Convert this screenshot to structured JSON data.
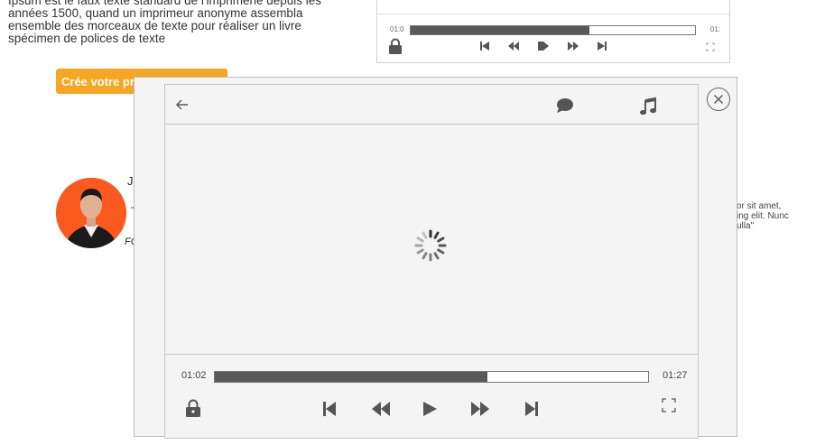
{
  "background": {
    "intro_lines": [
      "Ipsum est le faux texte standard de l'imprimerie depuis les",
      "années 1500, quand un imprimeur anonyme assembla",
      "ensemble des morceaux de texte pour réaliser un livre",
      "spécimen de polices de texte"
    ],
    "cta_label": "Crée votre premier",
    "mini_player": {
      "time_current": "01:0",
      "time_duration": "01:",
      "progress": 0.63
    },
    "profile_name_fragment": "J",
    "quote_fragment": "\"",
    "italic_fragment": "FO",
    "side_text": [
      "or sit amet,",
      "ing elit. Nunc",
      "ulla\""
    ]
  },
  "player": {
    "time_current": "01:02",
    "time_duration": "01:27",
    "progress": 0.63
  },
  "colors": {
    "accent": "#f5a623",
    "avatar_bg": "#fb5a1f",
    "progress_fill": "#595959",
    "icon": "#555555"
  },
  "icons": {
    "back": "arrow-left-icon",
    "comment": "speech-bubble-icon",
    "music": "music-note-icon",
    "close": "close-icon",
    "lock": "lock-icon",
    "skip_previous": "skip-previous-icon",
    "rewind": "rewind-icon",
    "play": "play-icon",
    "fast_forward": "fast-forward-icon",
    "skip_next": "skip-next-icon",
    "fullscreen": "fullscreen-icon",
    "loading": "loading-spinner-icon"
  }
}
